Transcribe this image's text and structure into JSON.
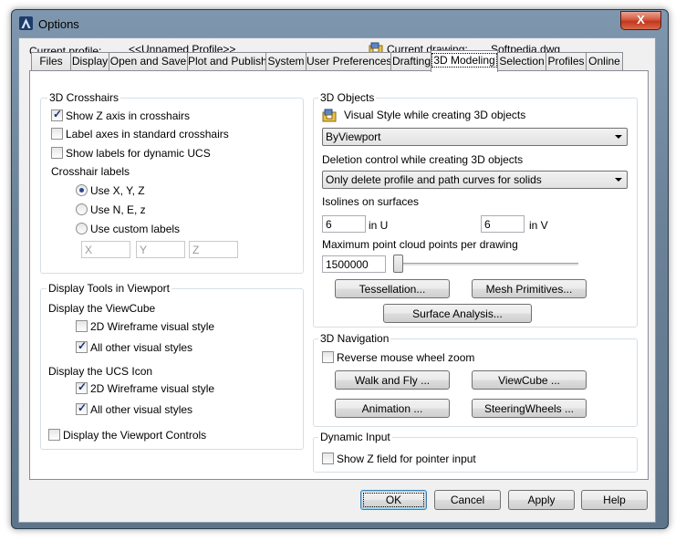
{
  "window": {
    "title": "Options",
    "close_label": "X"
  },
  "profile": {
    "current_profile_label": "Current profile:",
    "current_profile_value": "<<Unnamed Profile>>",
    "current_drawing_label": "Current drawing:",
    "current_drawing_value": "Softpedia.dwg"
  },
  "tabs": [
    {
      "label": "Files"
    },
    {
      "label": "Display"
    },
    {
      "label": "Open and Save"
    },
    {
      "label": "Plot and Publish"
    },
    {
      "label": "System"
    },
    {
      "label": "User Preferences"
    },
    {
      "label": "Drafting"
    },
    {
      "label": "3D Modeling",
      "active": true
    },
    {
      "label": "Selection"
    },
    {
      "label": "Profiles"
    },
    {
      "label": "Online"
    }
  ],
  "crosshairs": {
    "title": "3D Crosshairs",
    "show_z_axis": {
      "label": "Show Z axis in crosshairs",
      "checked": true
    },
    "label_axes": {
      "label": "Label axes in standard crosshairs",
      "checked": false
    },
    "show_labels_ucs": {
      "label": "Show labels for dynamic UCS",
      "checked": false
    },
    "crosshair_labels_title": "Crosshair labels",
    "use_xyz": {
      "label": "Use X, Y, Z",
      "checked": true
    },
    "use_nez": {
      "label": "Use N, E, z",
      "checked": false
    },
    "use_custom": {
      "label": "Use custom labels",
      "checked": false
    },
    "custom_x": "X",
    "custom_y": "Y",
    "custom_z": "Z"
  },
  "display_tools": {
    "title": "Display Tools in Viewport",
    "viewcube_title": "Display the ViewCube",
    "vc_2d_wireframe": {
      "label": "2D Wireframe visual style",
      "checked": false
    },
    "vc_all_other": {
      "label": "All other visual styles",
      "checked": true
    },
    "ucs_title": "Display the UCS Icon",
    "ucs_2d_wireframe": {
      "label": "2D Wireframe visual style",
      "checked": true
    },
    "ucs_all_other": {
      "label": "All other visual styles",
      "checked": true
    },
    "viewport_controls": {
      "label": "Display the Viewport Controls",
      "checked": false
    }
  },
  "objects": {
    "title": "3D Objects",
    "visual_style_label": "Visual Style while creating 3D objects",
    "visual_style_value": "ByViewport",
    "deletion_label": "Deletion control while creating 3D objects",
    "deletion_value": "Only delete profile and path curves for solids",
    "isolines_label": "Isolines on surfaces",
    "isolines_u": "6",
    "in_u": "in U",
    "isolines_v": "6",
    "in_v": "in V",
    "max_points_label": "Maximum point cloud points per drawing",
    "max_points_value": "1500000",
    "max_points_slider_fraction": 0,
    "tessellation_button": "Tessellation...",
    "mesh_primitives_button": "Mesh Primitives...",
    "surface_analysis_button": "Surface Analysis..."
  },
  "navigation": {
    "title": "3D Navigation",
    "reverse_wheel": {
      "label": "Reverse mouse wheel zoom",
      "checked": false
    },
    "walk_fly_button": "Walk and Fly ...",
    "viewcube_button": "ViewCube ...",
    "animation_button": "Animation ...",
    "steering_button": "SteeringWheels ..."
  },
  "dynamic_input": {
    "title": "Dynamic Input",
    "show_z_field": {
      "label": "Show Z field for pointer input",
      "checked": false
    }
  },
  "footer": {
    "ok": "OK",
    "cancel": "Cancel",
    "apply": "Apply",
    "help": "Help"
  },
  "colors": {
    "title_bar": "#6b8298",
    "close_button": "#c2361c",
    "accent": "#3c7fb1"
  }
}
